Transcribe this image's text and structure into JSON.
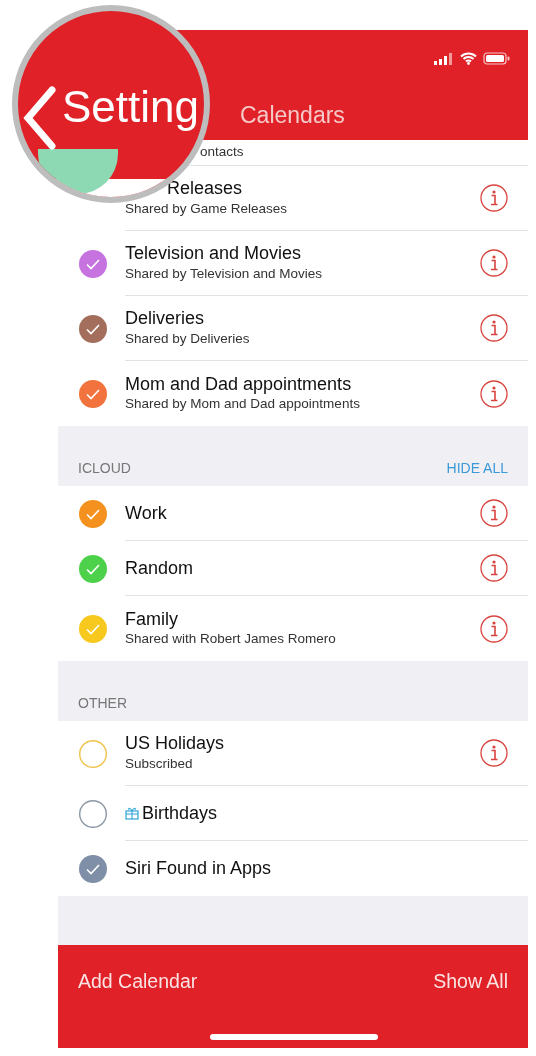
{
  "nav": {
    "back_label": "Setting",
    "title": "Calendars"
  },
  "sections": [
    {
      "items": [
        {
          "kind": "covered",
          "subtitle": "ontacts"
        },
        {
          "kind": "half-covered",
          "title": "Releases",
          "subtitle": "Shared by Game Releases",
          "info": true
        },
        {
          "kind": "calendar",
          "title": "Television and Movies",
          "subtitle": "Shared by Television and Movies",
          "checked": true,
          "color": "#c673e0",
          "info": true
        },
        {
          "kind": "calendar",
          "title": "Deliveries",
          "subtitle": "Shared by Deliveries",
          "checked": true,
          "color": "#a36f5c",
          "info": true
        },
        {
          "kind": "calendar",
          "title": "Mom and Dad appointments",
          "subtitle": "Shared by Mom and Dad appointments",
          "checked": true,
          "color": "#f2733d",
          "info": true
        }
      ]
    },
    {
      "header": "ICLOUD",
      "action": "HIDE ALL",
      "items": [
        {
          "kind": "calendar",
          "title": "Work",
          "checked": true,
          "color": "#f5911e",
          "info": true
        },
        {
          "kind": "calendar",
          "title": "Random",
          "checked": true,
          "color": "#4dd14a",
          "info": true
        },
        {
          "kind": "calendar",
          "title": "Family",
          "subtitle": "Shared with Robert James Romero",
          "checked": true,
          "color": "#f7c81e",
          "info": true
        }
      ]
    },
    {
      "header": "OTHER",
      "items": [
        {
          "kind": "calendar",
          "title": "US Holidays",
          "subtitle": "Subscribed",
          "checked": false,
          "color": "#f0c24a",
          "info": true
        },
        {
          "kind": "birthdays",
          "title": "Birthdays",
          "checked": false,
          "color": "#8c97a6",
          "info": false
        },
        {
          "kind": "calendar",
          "title": "Siri Found in Apps",
          "checked": true,
          "color": "#7f8fa8",
          "info": false
        }
      ]
    }
  ],
  "toolbar": {
    "left": "Add Calendar",
    "right": "Show All"
  }
}
